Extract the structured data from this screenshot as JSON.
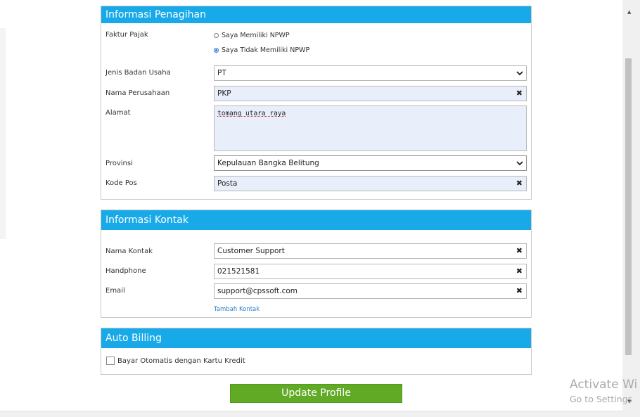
{
  "billing": {
    "header": "Informasi Penagihan",
    "tax_label": "Faktur Pajak",
    "tax_options": [
      {
        "label": "Saya Memiliki NPWP",
        "checked": false
      },
      {
        "label": "Saya Tidak Memiliki NPWP",
        "checked": true
      }
    ],
    "entity_type_label": "Jenis Badan Usaha",
    "entity_type_value": "PT",
    "company_label": "Nama Perusahaan",
    "company_value": "PKP",
    "address_label": "Alamat",
    "address_value": "tomang utara raya",
    "province_label": "Provinsi",
    "province_value": "Kepulauan Bangka Belitung",
    "postal_label": "Kode Pos",
    "postal_placeholder": "Posta"
  },
  "contact": {
    "header": "Informasi Kontak",
    "name_label": "Nama Kontak",
    "name_value": "Customer Support",
    "phone_label": "Handphone",
    "phone_value": "021521581",
    "email_label": "Email",
    "email_value": "support@cpssoft.com",
    "add_contact_link": "Tambah Kontak"
  },
  "auto_billing": {
    "header": "Auto Billing",
    "checkbox_label": "Bayar Otomatis dengan Kartu Kredit",
    "checked": false
  },
  "update_button_label": "Update Profile",
  "watermark": {
    "line1": "Activate Wi",
    "line2": "Go to Settings"
  },
  "colors": {
    "header_blue": "#18a9e8",
    "button_green": "#61aa25"
  }
}
